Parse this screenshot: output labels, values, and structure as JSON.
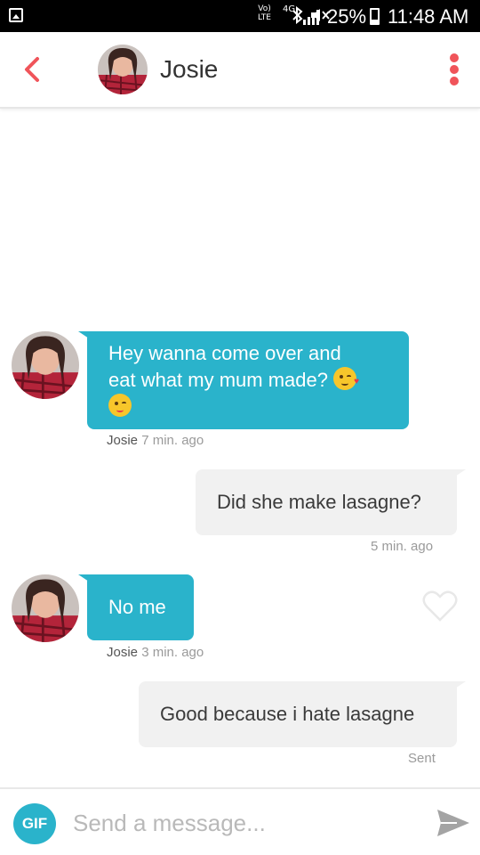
{
  "status_bar": {
    "lte_top": "Vo)",
    "lte_bottom": "LTE",
    "network": "4G",
    "battery": "25%",
    "time": "11:48 AM",
    "icons": [
      "image-icon",
      "bluetooth-icon",
      "mute-icon",
      "signal-icon",
      "battery-icon"
    ]
  },
  "header": {
    "name": "Josie",
    "back_icon": "chevron-left-icon",
    "menu_icon": "more-vertical-icon",
    "accent": "#f0545a"
  },
  "messages": [
    {
      "direction": "incoming",
      "line1": "Hey wanna come over and",
      "line2": "eat what my mum made?",
      "emojis": [
        "kissing-heart-emoji",
        "winking-tongue-emoji"
      ],
      "sender": "Josie",
      "time": "7 min. ago"
    },
    {
      "direction": "outgoing",
      "text": "Did she make lasagne?",
      "time": "5 min. ago"
    },
    {
      "direction": "incoming",
      "text": "No me",
      "sender": "Josie",
      "time": "3 min. ago"
    },
    {
      "direction": "outgoing",
      "text": "Good because i hate lasagne",
      "status": "Sent"
    }
  ],
  "composer": {
    "gif_label": "GIF",
    "placeholder": "Send a message...",
    "send_icon": "send-icon"
  },
  "colors": {
    "incoming_bubble": "#2ab3cb",
    "outgoing_bubble": "#f1f1f1",
    "accent": "#f0545a"
  }
}
